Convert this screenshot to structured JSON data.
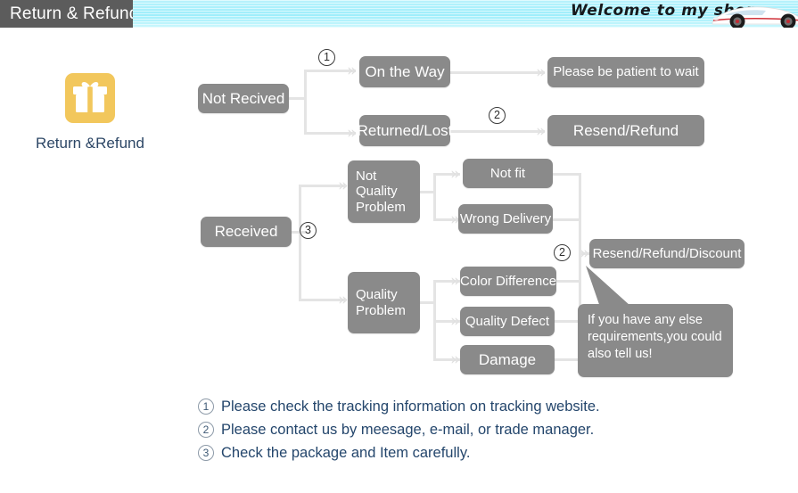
{
  "banner": {
    "title": "Return & Refund",
    "welcome": "Welcome to my shop",
    "car_icon": "sports-car-image"
  },
  "badge": {
    "icon": "gift-box-icon",
    "label": "Return &Refund"
  },
  "flow": {
    "start_not_received": "Not Recived",
    "start_received": "Received",
    "not_received_branches": [
      "On the Way",
      "Returned/Lost"
    ],
    "not_received_outcomes": [
      "Please be patient to wait",
      "Resend/Refund"
    ],
    "received_branches": [
      "Not Quality Problem",
      "Quality Problem"
    ],
    "not_quality_reasons": [
      "Not fit",
      "Wrong Delivery"
    ],
    "quality_reasons": [
      "Color Difference",
      "Quality Defect",
      "Damage"
    ],
    "received_outcome": "Resend/Refund/Discount",
    "bubble": "If you have any else requirements,you could also tell us!",
    "markers": {
      "on_the_way": "1",
      "returned_lost": "2",
      "received": "3",
      "resend_discount": "2"
    }
  },
  "legend": [
    {
      "num": "1",
      "text": "Please check the tracking information on tracking website."
    },
    {
      "num": "2",
      "text": "Please contact us by meesage, e-mail, or trade manager."
    },
    {
      "num": "3",
      "text": "Check the package and Item carefully."
    }
  ],
  "colors": {
    "banner_bg": "#9eeefb",
    "banner_title_bg": "#5c5c5c",
    "node_bg": "#8a8a8a",
    "connector": "#e4e4e4",
    "gift_gold": "#f2c75c",
    "legend_text": "#24466c"
  }
}
